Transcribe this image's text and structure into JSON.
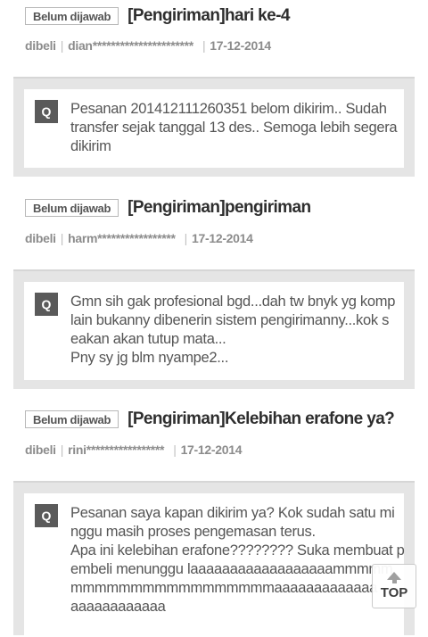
{
  "questions": [
    {
      "badge": "Belum dijawab",
      "title": "[Pengiriman]hari ke-4",
      "buyer": "dibeli",
      "user": "dian**********************",
      "date": "17-12-2014",
      "q_label": "Q",
      "lines": [
        "Pesanan 201412111260351 belom dikirim.. Sudah",
        "transfer sejak tanggal 13 des.. Semoga lebih segera",
        "dikirim"
      ]
    },
    {
      "badge": "Belum dijawab",
      "title": "[Pengiriman]pengiriman",
      "buyer": "dibeli",
      "user": "harm*****************",
      "date": "17-12-2014",
      "q_label": "Q",
      "lines": [
        "Gmn sih gak profesional bgd...dah tw bnyk yg komp",
        "lain bukanny dibenerin sistem pengirimanny...kok s",
        "eakan akan tutup mata...",
        "Pny sy jg blm nyampe2..."
      ]
    },
    {
      "badge": "Belum dijawab",
      "title": "[Pengiriman]Kelebihan erafone ya?",
      "buyer": "dibeli",
      "user": "rini*****************",
      "date": "17-12-2014",
      "q_label": "Q",
      "lines": [
        "Pesanan saya kapan dikirim ya? Kok sudah satu mi",
        "nggu masih proses pengemasan terus.",
        "Apa ini kelebihan erafone???????? Suka membuat p",
        "embeli menunggu laaaaaaaaaaaaaaaaaammmmm",
        "mmmmmmmmmmmmmmmmmaaaaaaaaaaaaa",
        "aaaaaaaaaaaa"
      ]
    }
  ],
  "top_button": {
    "label": "TOP",
    "icon": "arrow-up-icon"
  }
}
